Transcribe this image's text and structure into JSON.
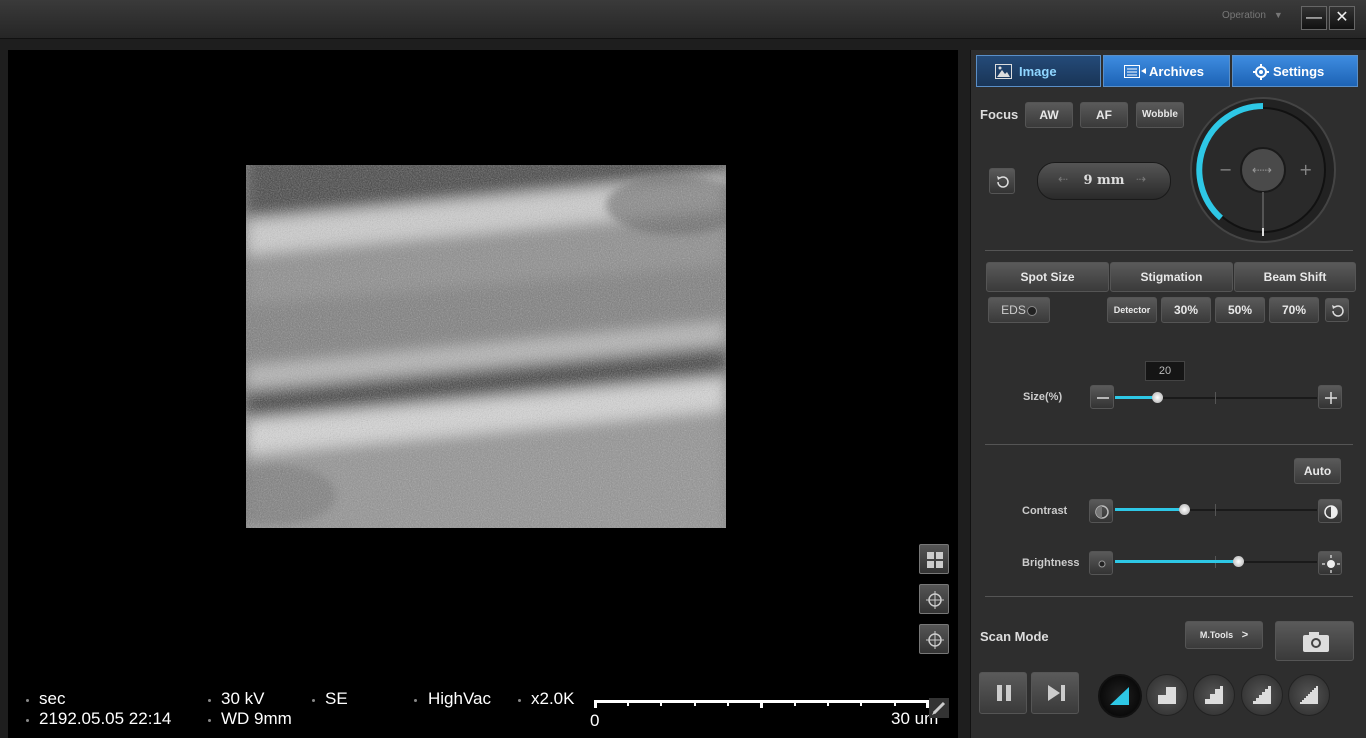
{
  "window": {
    "operation_menu": "Operation",
    "minimize_label": "—",
    "close_label": "✕"
  },
  "tabs": [
    {
      "label": "Image",
      "icon": "image-icon"
    },
    {
      "label": "Archives",
      "icon": "archives-icon"
    },
    {
      "label": "Settings",
      "icon": "gear-icon"
    }
  ],
  "focus": {
    "label": "Focus",
    "buttons": [
      "AW",
      "AF",
      "Wobble"
    ],
    "working_distance": "9 mm"
  },
  "subtabs": [
    "Spot Size",
    "Stigmation",
    "Beam Shift"
  ],
  "spot": {
    "eds_label": "EDS",
    "detector_label": "Detector",
    "presets": [
      "30%",
      "50%",
      "70%"
    ],
    "size_label": "Size(%)",
    "size_value": "20",
    "size_fraction": 0.21
  },
  "adjust": {
    "auto_label": "Auto",
    "contrast_label": "Contrast",
    "contrast_fraction": 0.34,
    "brightness_label": "Brightness",
    "brightness_fraction": 0.61
  },
  "scan": {
    "label": "Scan Mode",
    "mtools_label": "M.Tools",
    "mtools_chevron": ">"
  },
  "status": {
    "scan_time": "sec",
    "datetime": "2192.05.05 22:14",
    "voltage": "30 kV",
    "working_distance": "WD 9mm",
    "detector": "SE",
    "vacuum": "HighVac",
    "magnification": "x2.0K",
    "scale_start": "0",
    "scale_end": "30 um"
  },
  "colors": {
    "accent": "#2ec8e6",
    "tab_blue": "#1d63b5"
  }
}
